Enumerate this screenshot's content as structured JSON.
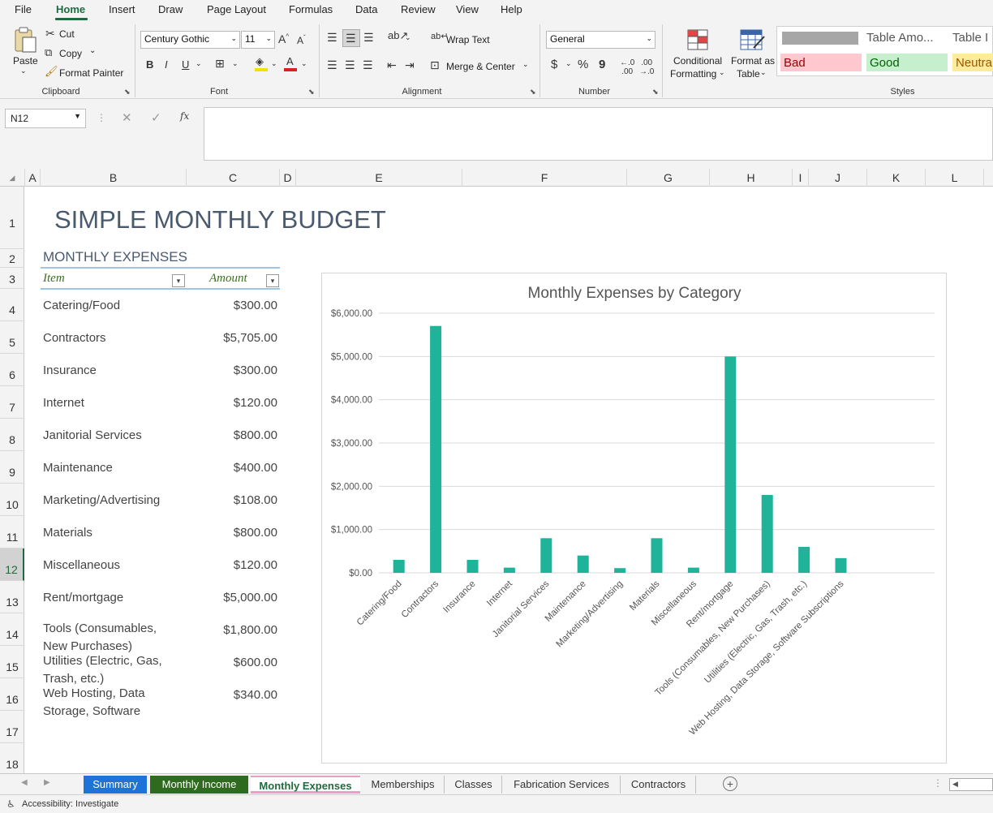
{
  "menu": [
    "File",
    "Home",
    "Insert",
    "Draw",
    "Page Layout",
    "Formulas",
    "Data",
    "Review",
    "View",
    "Help"
  ],
  "ribbon": {
    "clipboard": {
      "paste": "Paste",
      "cut": "Cut",
      "copy": "Copy",
      "format_painter": "Format Painter",
      "label": "Clipboard"
    },
    "font": {
      "family": "Century Gothic",
      "size": "11",
      "bold": "B",
      "italic": "I",
      "underline": "U",
      "label": "Font"
    },
    "alignment": {
      "wrap_text": "Wrap Text",
      "merge_center": "Merge & Center",
      "label": "Alignment"
    },
    "number": {
      "format": "General",
      "currency": "$",
      "percent": "%",
      "comma": "9",
      "label": "Number"
    },
    "styles": {
      "conditional": "Conditional",
      "conditional2": "Formatting",
      "format_as": "Format as",
      "format_as2": "Table",
      "cells": [
        "Table Amo...",
        "Table I",
        "Bad",
        "Good",
        "Neutra"
      ],
      "label": "Styles"
    }
  },
  "namebox": "N12",
  "columns": [
    "A",
    "B",
    "C",
    "D",
    "E",
    "F",
    "G",
    "H",
    "I",
    "J",
    "K",
    "L"
  ],
  "rows": [
    "1",
    "2",
    "3",
    "4",
    "5",
    "6",
    "7",
    "8",
    "9",
    "10",
    "11",
    "12",
    "13",
    "14",
    "15",
    "16",
    "17",
    "18"
  ],
  "sheet": {
    "title": "SIMPLE MONTHLY BUDGET",
    "section": "MONTHLY EXPENSES",
    "header_item": "Item",
    "header_amount": "Amount",
    "items": [
      {
        "l1": "Catering/Food",
        "l2": "",
        "amount": "$300.00"
      },
      {
        "l1": "Contractors",
        "l2": "",
        "amount": "$5,705.00"
      },
      {
        "l1": "Insurance",
        "l2": "",
        "amount": "$300.00"
      },
      {
        "l1": "Internet",
        "l2": "",
        "amount": "$120.00"
      },
      {
        "l1": "Janitorial Services",
        "l2": "",
        "amount": "$800.00"
      },
      {
        "l1": "Maintenance",
        "l2": "",
        "amount": "$400.00"
      },
      {
        "l1": "Marketing/Advertising",
        "l2": "",
        "amount": "$108.00"
      },
      {
        "l1": "Materials",
        "l2": "",
        "amount": "$800.00"
      },
      {
        "l1": "Miscellaneous",
        "l2": "",
        "amount": "$120.00"
      },
      {
        "l1": "Rent/mortgage",
        "l2": "",
        "amount": "$5,000.00"
      },
      {
        "l1": "Tools (Consumables,",
        "l2": "New Purchases)",
        "amount": "$1,800.00"
      },
      {
        "l1": "Utilities (Electric, Gas,",
        "l2": "Trash, etc.)",
        "amount": "$600.00"
      },
      {
        "l1": "Web Hosting, Data",
        "l2": "Storage, Software",
        "amount": "$340.00"
      }
    ]
  },
  "chart_data": {
    "type": "bar",
    "title": "Monthly Expenses by Category",
    "categories": [
      "Catering/Food",
      "Contractors",
      "Insurance",
      "Internet",
      "Janitorial Services",
      "Maintenance",
      "Marketing/Advertising",
      "Materials",
      "Miscellaneous",
      "Rent/mortgage",
      "Tools (Consumables, New Purchases)",
      "Utilities (Electric, Gas, Trash, etc.)",
      "Web Hosting, Data Storage, Software Subscriptions"
    ],
    "values": [
      300,
      5705,
      300,
      120,
      800,
      400,
      108,
      800,
      120,
      5000,
      1800,
      600,
      340
    ],
    "ylim": [
      0,
      6000
    ],
    "yticks": [
      "$0.00",
      "$1,000.00",
      "$2,000.00",
      "$3,000.00",
      "$4,000.00",
      "$5,000.00",
      "$6,000.00"
    ],
    "grid": true,
    "bar_color": "#1fb39a"
  },
  "tabs": [
    "Summary",
    "Monthly Income",
    "Monthly Expenses",
    "Memberships",
    "Classes",
    "Fabrication Services",
    "Contractors"
  ],
  "tab_colors": {
    "summary": "#1f73d8",
    "income": "#2f6b1e",
    "expenses_accent": "#e8a0c8"
  },
  "status": "Accessibility: Investigate"
}
